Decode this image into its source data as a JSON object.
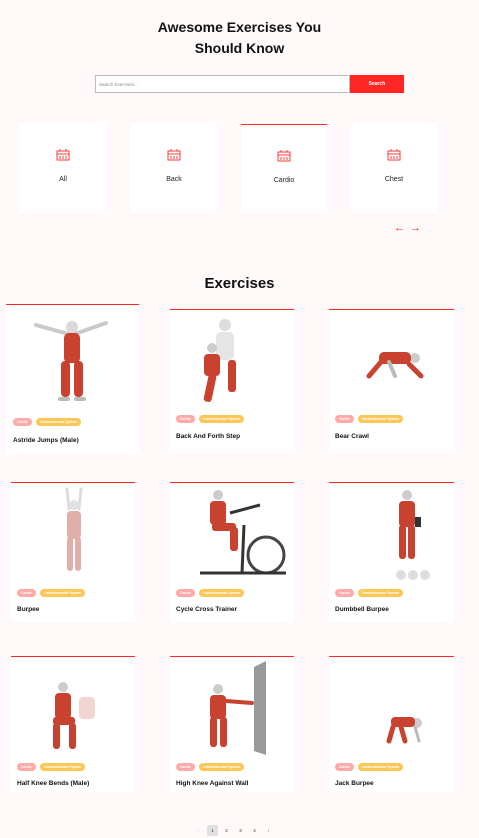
{
  "hero": {
    "title_line1": "Awesome Exercises You",
    "title_line2": "Should Know"
  },
  "search": {
    "placeholder": "Search Exercises...",
    "button_label": "Search"
  },
  "categories": [
    {
      "label": "All",
      "icon": "gym-icon"
    },
    {
      "label": "Back",
      "icon": "gym-icon"
    },
    {
      "label": "Cardio",
      "icon": "gym-icon",
      "selected": true
    },
    {
      "label": "Chest",
      "icon": "gym-icon"
    }
  ],
  "scroll_arrows": {
    "left": "←",
    "right": "→"
  },
  "section_title": "Exercises",
  "exercises": [
    {
      "name": "Astride Jumps (Male)",
      "body_part": "Cardio",
      "target": "Cardiovascular System"
    },
    {
      "name": "Back And Forth Step",
      "body_part": "Cardio",
      "target": "Cardiovascular System"
    },
    {
      "name": "Bear Crawl",
      "body_part": "Cardio",
      "target": "Cardiovascular System"
    },
    {
      "name": "Burpee",
      "body_part": "Cardio",
      "target": "Cardiovascular System"
    },
    {
      "name": "Cycle Cross Trainer",
      "body_part": "Cardio",
      "target": "Cardiovascular System"
    },
    {
      "name": "Dumbbell Burpee",
      "body_part": "Cardio",
      "target": "Cardiovascular System"
    },
    {
      "name": "Half Knee Bends (Male)",
      "body_part": "Cardio",
      "target": "Cardiovascular System"
    },
    {
      "name": "High Knee Against Wall",
      "body_part": "Cardio",
      "target": "Cardiovascular System"
    },
    {
      "name": "Jack Burpee",
      "body_part": "Cardio",
      "target": "Cardiovascular System"
    }
  ],
  "pagination": {
    "prev": "‹",
    "pages": [
      "1",
      "2",
      "3",
      "4"
    ],
    "current": "1",
    "next": "›"
  },
  "colors": {
    "accent": "#ff2625",
    "tag_body": "#ffa9a9",
    "tag_target": "#fcc757",
    "background": "#fff9f9"
  }
}
